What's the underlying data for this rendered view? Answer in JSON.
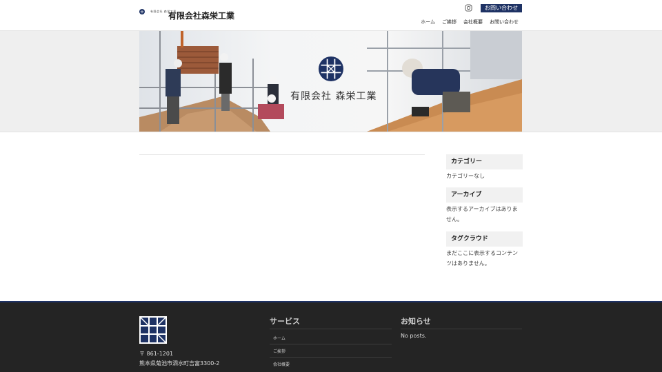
{
  "header": {
    "logo_small_text": "有限会社 森栄工業",
    "site_title": "有限会社森栄工業",
    "contact_button": "お問い合わせ",
    "nav": [
      "ホーム",
      "ご挨拶",
      "会社概要",
      "お問い合わせ"
    ]
  },
  "hero": {
    "title": "有限会社 森栄工業"
  },
  "sidebar": {
    "widgets": [
      {
        "title": "カテゴリー",
        "body": "カテゴリーなし"
      },
      {
        "title": "アーカイブ",
        "body": "表示するアーカイブはありません。"
      },
      {
        "title": "タグクラウド",
        "body": "まだここに表示するコンテンツはありません。"
      }
    ]
  },
  "footer": {
    "postal": "〒 861-1201",
    "address": "熊本県菊池市泗水町吉富3300-2",
    "services_title": "サービス",
    "services_links": [
      "ホーム",
      "ご挨拶",
      "会社概要"
    ],
    "news_title": "お知らせ",
    "news_empty": "No posts."
  },
  "colors": {
    "accent": "#1e3264",
    "footer_bg": "#242424",
    "widget_bg": "#f1f1f1"
  },
  "icons": [
    "logo-mark-icon",
    "instagram-icon"
  ]
}
